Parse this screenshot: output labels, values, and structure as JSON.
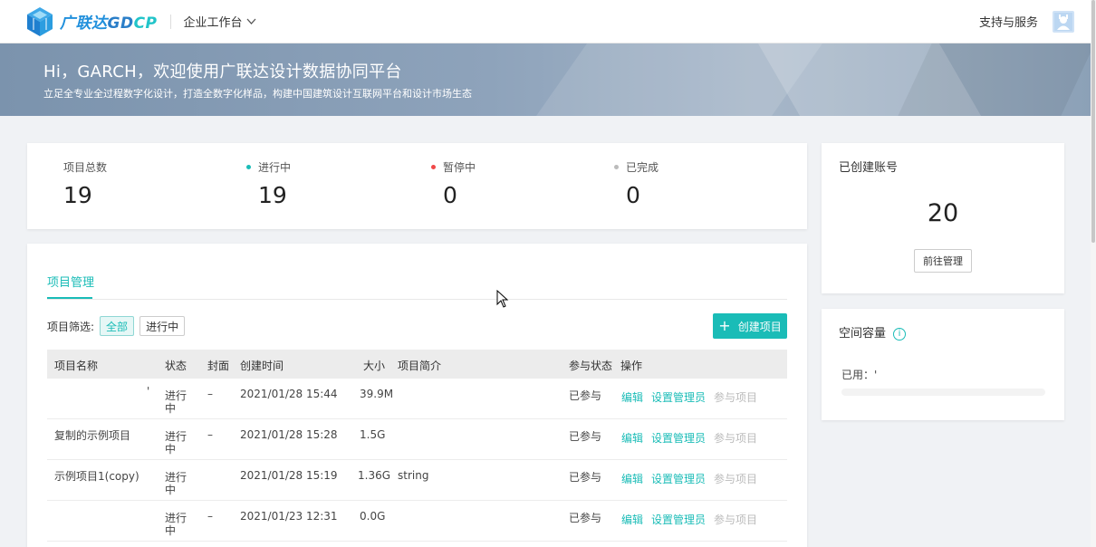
{
  "header": {
    "brand_prefix": "广联达",
    "brand_gd": "GD",
    "brand_cp": "CP",
    "workbench_label": "企业工作台",
    "support_label": "支持与服务"
  },
  "banner": {
    "title": "Hi，GARCH，欢迎使用广联达设计数据协同平台",
    "subtitle": "立足全专业全过程数字化设计，打造全数字化样品，构建中国建筑设计互联网平台和设计市场生态"
  },
  "stats": {
    "total": {
      "label": "项目总数",
      "value": "19"
    },
    "ongoing": {
      "label": "进行中",
      "value": "19",
      "color": "#1abcb7"
    },
    "paused": {
      "label": "暂停中",
      "value": "0",
      "color": "#f04848"
    },
    "done": {
      "label": "已完成",
      "value": "0",
      "color": "#bbbbbb"
    }
  },
  "projects": {
    "tab_label": "项目管理",
    "filter_label": "项目筛选:",
    "filter_all": "全部",
    "filter_ongoing": "进行中",
    "create_label": "创建项目",
    "columns": {
      "name": "项目名称",
      "status": "状态",
      "cover": "封面",
      "created": "创建时间",
      "size": "大小",
      "desc": "项目简介",
      "participation": "参与状态",
      "actions": "操作"
    },
    "rows": [
      {
        "name": "'",
        "status1": "进行",
        "status2": "中",
        "cover": "–",
        "created": "2021/01/28 15:44",
        "size": "39.9M",
        "desc": "",
        "participation": "已参与",
        "edit": "编辑",
        "admin": "设置管理员",
        "join": "参与项目"
      },
      {
        "name": "复制的示例项目",
        "status1": "进行",
        "status2": "中",
        "cover": "–",
        "created": "2021/01/28 15:28",
        "size": "1.5G",
        "desc": "",
        "participation": "已参与",
        "edit": "编辑",
        "admin": "设置管理员",
        "join": "参与项目"
      },
      {
        "name": "示例项目1(copy)",
        "status1": "进行",
        "status2": "中",
        "cover": "",
        "created": "2021/01/28 15:19",
        "size": "1.36G",
        "desc": "string",
        "participation": "已参与",
        "edit": "编辑",
        "admin": "设置管理员",
        "join": "参与项目"
      },
      {
        "name": "",
        "status1": "进行",
        "status2": "中",
        "cover": "–",
        "created": "2021/01/23 12:31",
        "size": "0.0G",
        "desc": "",
        "participation": "已参与",
        "edit": "编辑",
        "admin": "设置管理员",
        "join": "参与项目"
      }
    ]
  },
  "accounts": {
    "title": "已创建账号",
    "value": "20",
    "manage_label": "前往管理"
  },
  "space": {
    "title": "空间容量",
    "used_label": "已用：",
    "used_value": "'"
  }
}
